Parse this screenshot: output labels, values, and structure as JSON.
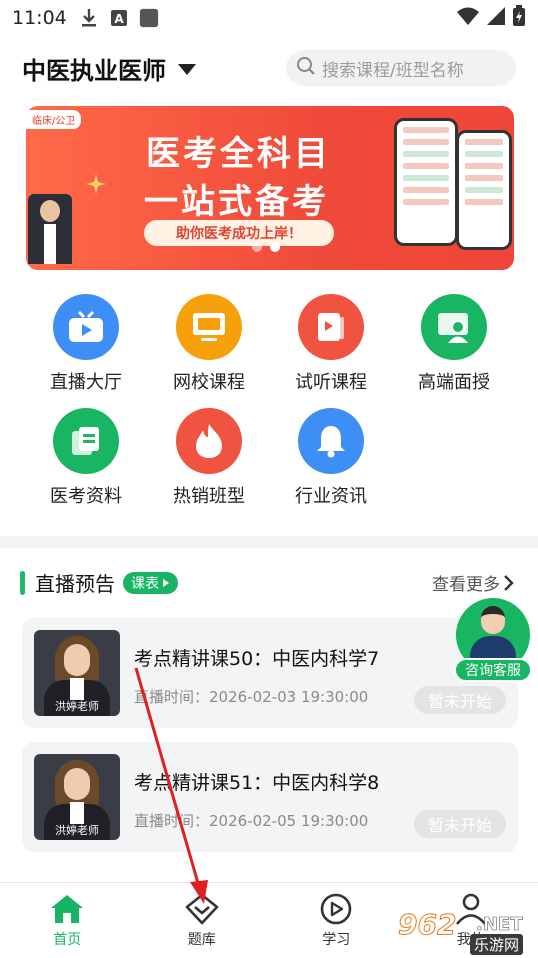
{
  "status_bar": {
    "time": "11:04",
    "left_icons": [
      "download-icon",
      "text-a-icon",
      "square-app-icon"
    ],
    "right_icons": [
      "wifi-icon",
      "signal-icon",
      "battery-icon"
    ]
  },
  "header": {
    "exam_title": "中医执业医师",
    "search_placeholder": "搜索课程/班型名称"
  },
  "banner": {
    "tag": "临床/公卫",
    "line1": "医考全科目",
    "line2": "一站式备考",
    "pill": "助你医考成功上岸！",
    "slide_count": 2,
    "active_slide": 2
  },
  "quick_menu": [
    {
      "label": "直播大厅",
      "icon": "live-tv-icon",
      "color": "#3d8ef5"
    },
    {
      "label": "网校课程",
      "icon": "monitor-icon",
      "color": "#f6a00c"
    },
    {
      "label": "试听课程",
      "icon": "play-book-icon",
      "color": "#f0533f"
    },
    {
      "label": "高端面授",
      "icon": "teacher-board-icon",
      "color": "#19b563"
    },
    {
      "label": "医考资料",
      "icon": "documents-icon",
      "color": "#19b563"
    },
    {
      "label": "热销班型",
      "icon": "fire-icon",
      "color": "#f0533f"
    },
    {
      "label": "行业资讯",
      "icon": "bell-icon",
      "color": "#3d8ef5"
    }
  ],
  "live": {
    "title": "直播预告",
    "badge": "课表",
    "see_more": "查看更多",
    "courses": [
      {
        "title": "考点精讲课50：中医内科学7",
        "time": "直播时间：2026-02-03 19:30:00",
        "status": "暂未开始",
        "teacher_caption": "洪婷老师"
      },
      {
        "title": "考点精讲课51：中医内科学8",
        "time": "直播时间：2026-02-05 19:30:00",
        "status": "暂未开始",
        "teacher_caption": "洪婷老师"
      }
    ]
  },
  "service": {
    "label": "咨询客服"
  },
  "bottom_nav": [
    {
      "label": "首页",
      "icon": "home-icon",
      "active": true
    },
    {
      "label": "题库",
      "icon": "question-bank-icon",
      "active": false
    },
    {
      "label": "学习",
      "icon": "play-circle-icon",
      "active": false
    },
    {
      "label": "我的",
      "icon": "profile-icon",
      "active": false
    }
  ],
  "watermark": {
    "number": "962",
    "net": ".NET",
    "text": "乐游网"
  },
  "colors": {
    "brand_green": "#18b463",
    "annotation_red": "#e02020"
  }
}
